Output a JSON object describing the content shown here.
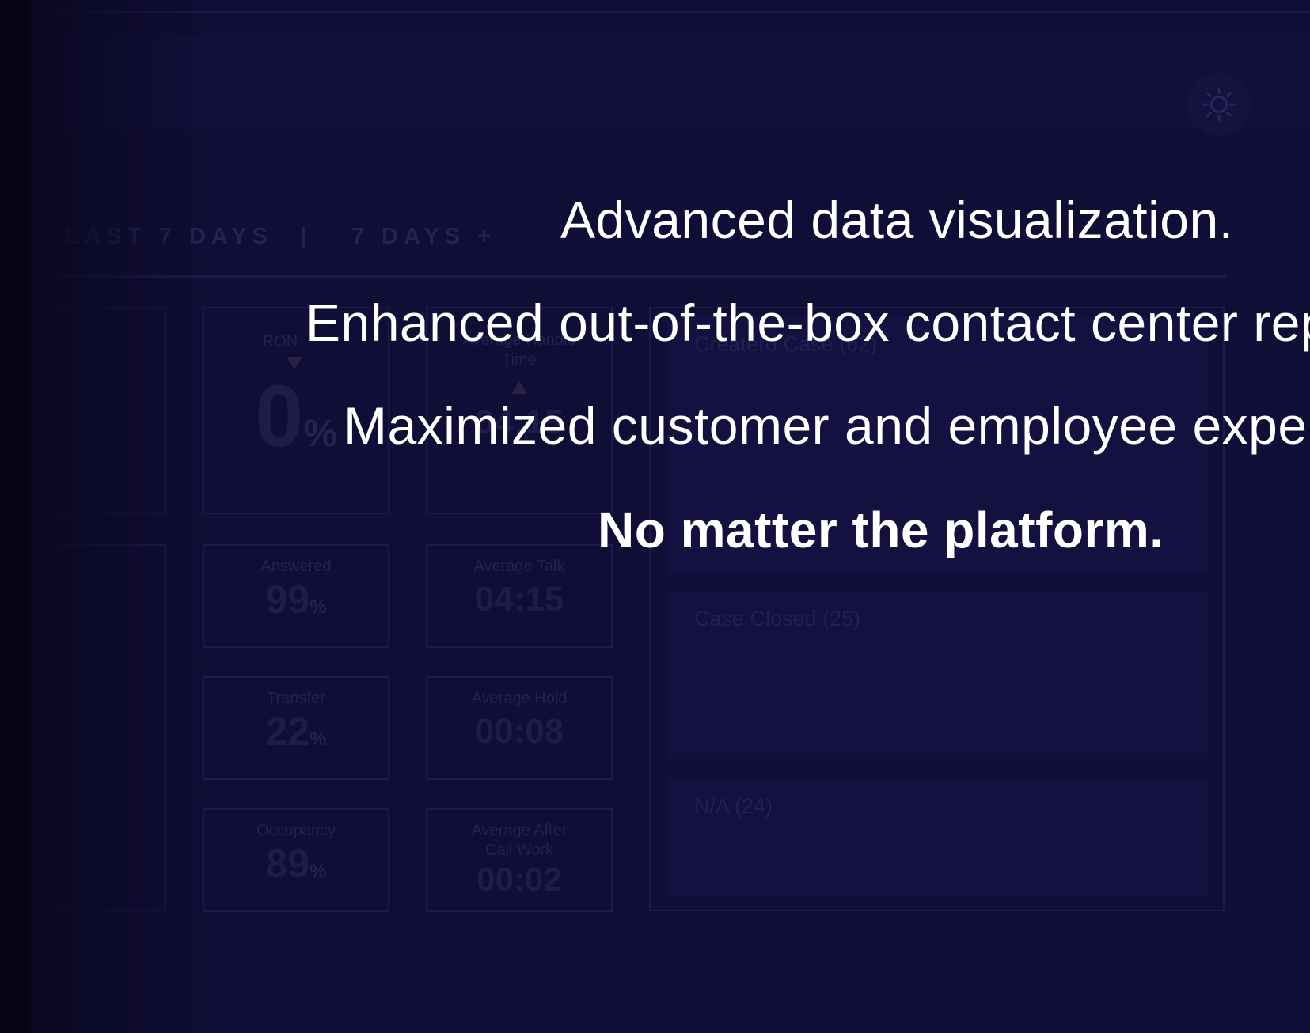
{
  "header": {
    "settings_icon": "sun-gear-icon"
  },
  "range_tabs": {
    "last7": "LAST 7 DAYS",
    "separator": "|",
    "plus7": "7 DAYS +"
  },
  "metrics": {
    "ron": {
      "label": "RON",
      "value": "0",
      "unit": "%",
      "trend": "down"
    },
    "aht": {
      "label": "Average Handle Time",
      "value": "04:15",
      "trend": "up"
    },
    "answered": {
      "label": "Answered",
      "value": "99",
      "unit": "%"
    },
    "average_talk": {
      "label": "Average Talk",
      "value": "04:15"
    },
    "transfer": {
      "label": "Transfer",
      "value": "22",
      "unit": "%"
    },
    "average_hold": {
      "label": "Average Hold",
      "value": "00:08"
    },
    "occupancy": {
      "label": "Occupancy",
      "value": "89",
      "unit": "%"
    },
    "acw": {
      "label": "Average After Call Work",
      "value": "00:02"
    }
  },
  "cases": {
    "created": "Createrd Case (62)",
    "closed": "Case Closed (25)",
    "na": "N/A (24)"
  },
  "overlay": {
    "line1": "Advanced data visualization.",
    "line2": "Enhanced out-of-the-box contact center rep",
    "line3": "Maximized customer and employee experi",
    "line4": "No matter the platform."
  },
  "colors": {
    "background": "#100d36",
    "overlay_text": "#ffffff",
    "faded_text": "#252253"
  }
}
